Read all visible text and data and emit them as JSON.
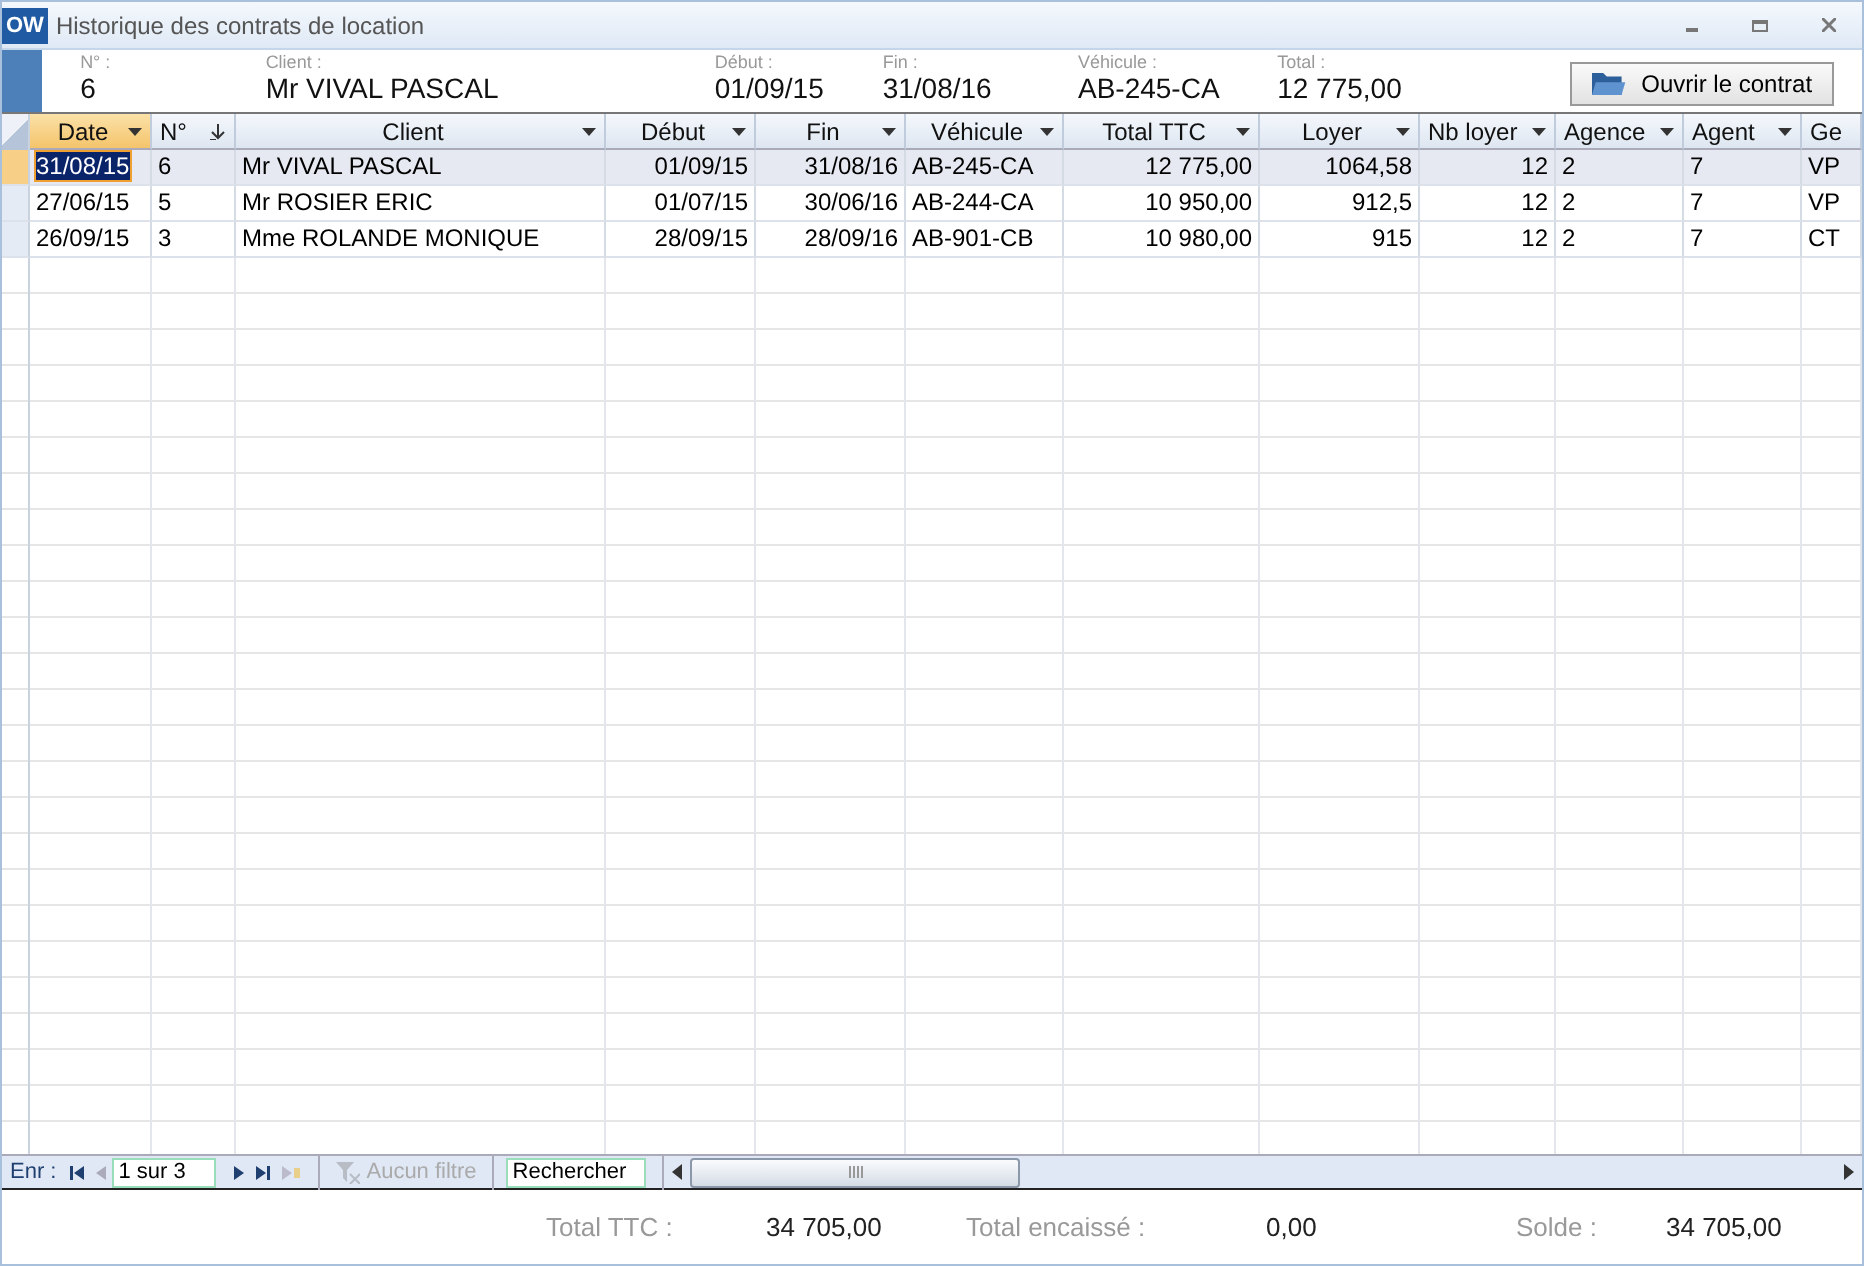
{
  "window": {
    "icon": "OW",
    "title": "Historique des contrats de location"
  },
  "summary": {
    "fields": [
      {
        "label": "N° :",
        "value": "6"
      },
      {
        "label": "Client :",
        "value": "Mr VIVAL PASCAL"
      },
      {
        "label": "Début :",
        "value": "01/09/15"
      },
      {
        "label": "Fin :",
        "value": "31/08/16"
      },
      {
        "label": "Véhicule :",
        "value": "AB-245-CA"
      },
      {
        "label": "Total :",
        "value": "12 775,00"
      }
    ],
    "button": "Ouvrir le contrat"
  },
  "table": {
    "columns": [
      {
        "label": "Date",
        "selected": true,
        "kind": "dropdown"
      },
      {
        "label": "N°",
        "selected": false,
        "kind": "sorted"
      },
      {
        "label": "Client",
        "selected": false,
        "kind": "dropdown"
      },
      {
        "label": "Début",
        "selected": false,
        "kind": "dropdown"
      },
      {
        "label": "Fin",
        "selected": false,
        "kind": "dropdown"
      },
      {
        "label": "Véhicule",
        "selected": false,
        "kind": "dropdown"
      },
      {
        "label": "Total TTC",
        "selected": false,
        "kind": "dropdown"
      },
      {
        "label": "Loyer",
        "selected": false,
        "kind": "dropdown"
      },
      {
        "label": "Nb loyer",
        "selected": false,
        "kind": "dropdown"
      },
      {
        "label": "Agence",
        "selected": false,
        "kind": "dropdown"
      },
      {
        "label": "Agent",
        "selected": false,
        "kind": "dropdown"
      },
      {
        "label": "Ge",
        "selected": false,
        "kind": "cut"
      }
    ],
    "rows": [
      {
        "selected": true,
        "cells": [
          "31/08/15",
          "6",
          "Mr VIVAL PASCAL",
          "01/09/15",
          "31/08/16",
          "AB-245-CA",
          "12 775,00",
          "1064,58",
          "12",
          "2",
          "7",
          "VP"
        ]
      },
      {
        "selected": false,
        "cells": [
          "27/06/15",
          "5",
          "Mr ROSIER ERIC",
          "01/07/15",
          "30/06/16",
          "AB-244-CA",
          "10 950,00",
          "912,5",
          "12",
          "2",
          "7",
          "VP"
        ]
      },
      {
        "selected": false,
        "cells": [
          "26/09/15",
          "3",
          "Mme ROLANDE MONIQUE",
          "28/09/15",
          "28/09/16",
          "AB-901-CB",
          "10 980,00",
          "915",
          "12",
          "2",
          "7",
          "CT"
        ]
      }
    ]
  },
  "navigator": {
    "label": "Enr :",
    "position": "1 sur 3",
    "filter": "Aucun filtre",
    "search": "Rechercher"
  },
  "totals": [
    {
      "label": "Total TTC :",
      "value": "34 705,00"
    },
    {
      "label": "Total encaissé :",
      "value": "0,00"
    },
    {
      "label": "Solde :",
      "value": "34 705,00"
    }
  ]
}
